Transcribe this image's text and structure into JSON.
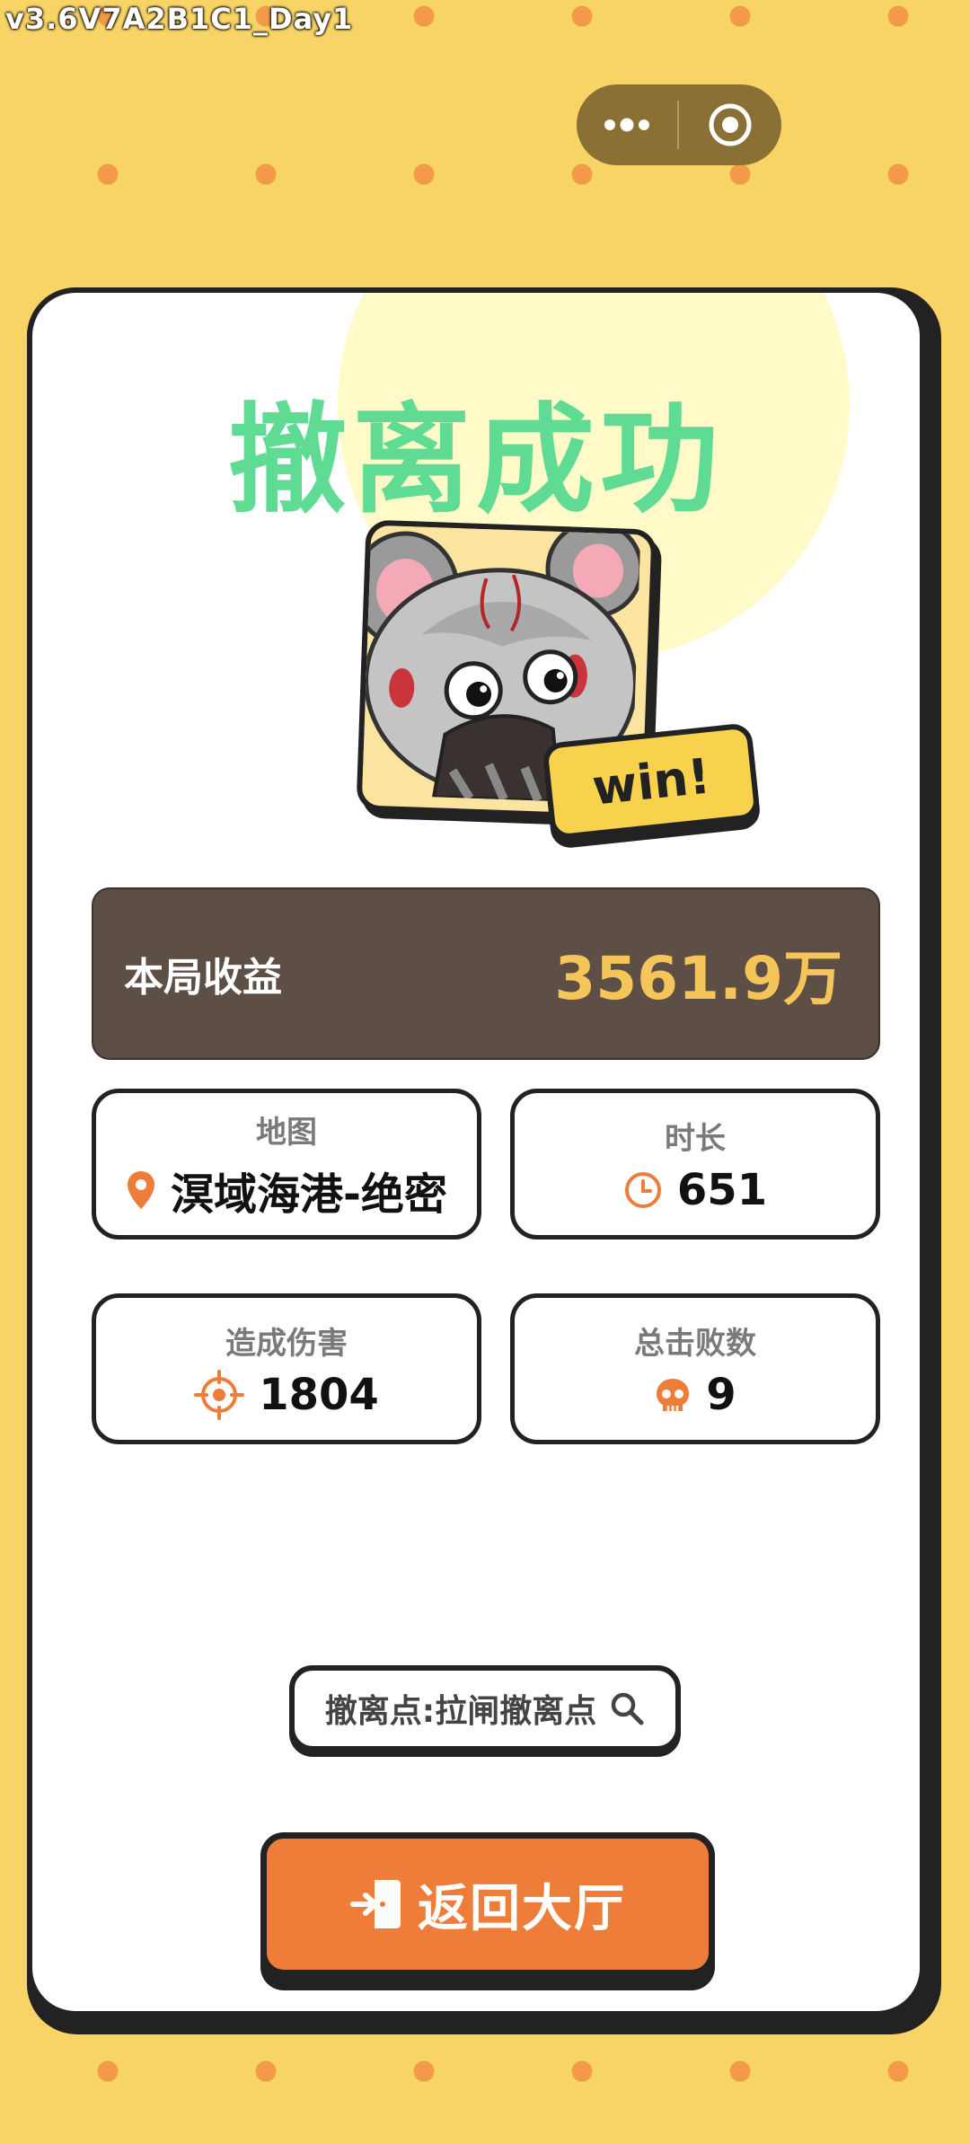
{
  "version_label": "v3.6V7A2B1C1_Day1",
  "capsule": {
    "more_icon": "more-dots-icon",
    "close_icon": "target-circle-icon"
  },
  "result": {
    "title": "撤离成功",
    "badge": "win!",
    "avatar_icon": "mouse-avatar-icon"
  },
  "earnings": {
    "label": "本局收益",
    "value": "3561.9万"
  },
  "stats": {
    "map": {
      "label": "地图",
      "value": "溟域海港-绝密",
      "icon": "location-pin-icon"
    },
    "duration": {
      "label": "时长",
      "value": "651",
      "icon": "clock-icon"
    },
    "damage": {
      "label": "造成伤害",
      "value": "1804",
      "icon": "crosshair-icon"
    },
    "kills": {
      "label": "总击败数",
      "value": "9",
      "icon": "skull-icon"
    }
  },
  "extraction": {
    "text": "撤离点:拉闸撤离点",
    "icon": "search-icon"
  },
  "return_button": {
    "label": "返回大厅",
    "icon": "exit-door-icon"
  },
  "colors": {
    "background": "#f8d466",
    "dots": "#f29a4a",
    "title": "#5fdb93",
    "earnings_panel": "#5e4f46",
    "earnings_value": "#f6c55a",
    "accent_orange": "#ed7d38",
    "badge_yellow": "#f8d14d"
  }
}
